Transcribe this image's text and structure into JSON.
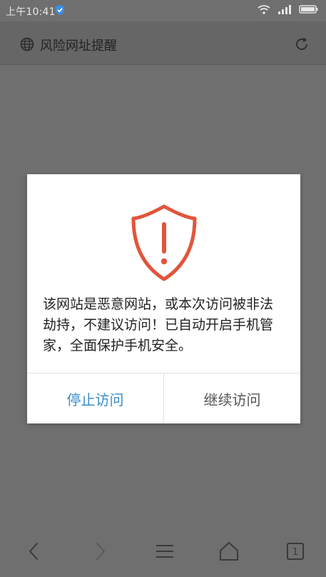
{
  "status_bar": {
    "time": "上午10:41",
    "icons": [
      "shield-icon",
      "wifi-icon",
      "signal-icon",
      "battery-icon"
    ]
  },
  "address_bar": {
    "title": "风险网址提醒",
    "icons": [
      "globe-icon",
      "reload-icon"
    ]
  },
  "dialog": {
    "message": "该网站是恶意网站，或本次访问被非法劫持，不建议访问！已自动开启手机管家，全面保护手机安全。",
    "stop_label": "停止访问",
    "continue_label": "继续访问",
    "accent_color": "#e2553b",
    "link_color": "#3a8ec9"
  },
  "bottom_nav": {
    "tab_count": "1",
    "icons": [
      "back-icon",
      "forward-icon",
      "menu-icon",
      "home-icon",
      "tabs-icon"
    ]
  }
}
